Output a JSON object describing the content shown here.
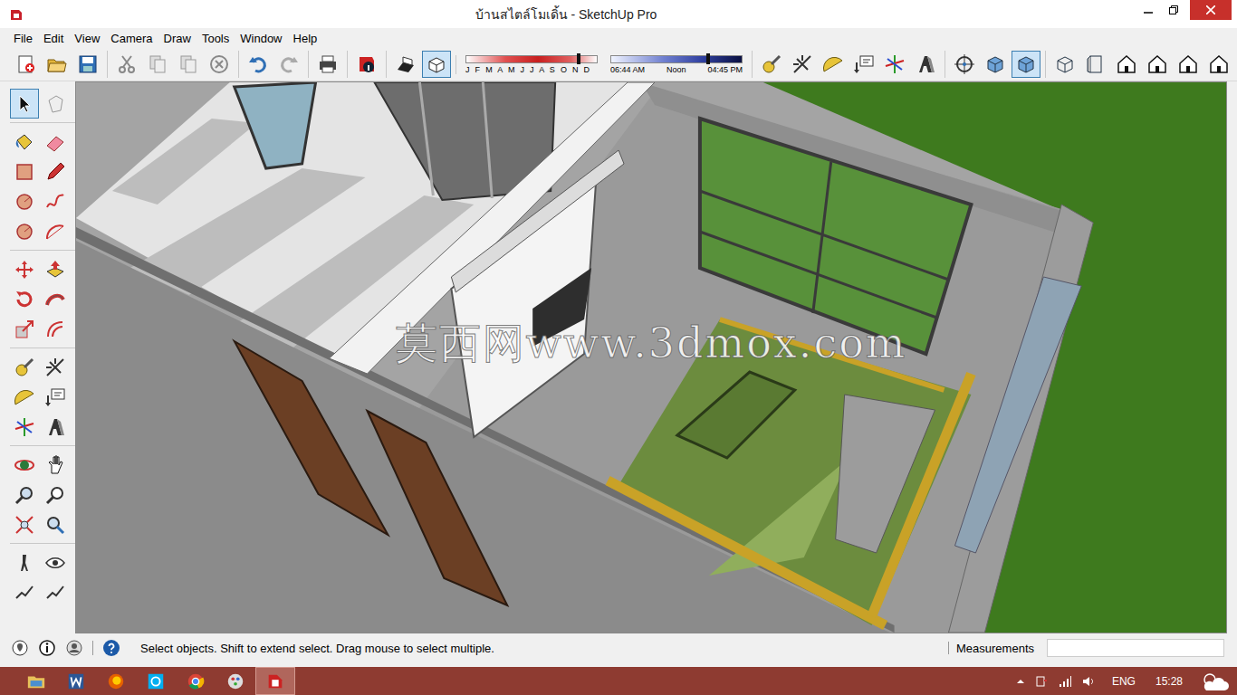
{
  "window": {
    "title": "บ้านสไตล์โมเดิ้น - SketchUp Pro"
  },
  "menu": [
    "File",
    "Edit",
    "View",
    "Camera",
    "Draw",
    "Tools",
    "Window",
    "Help"
  ],
  "toolbar": {
    "left_groups": [
      [
        {
          "pressed": false
        },
        {
          "pressed": false
        },
        {
          "pressed": false
        }
      ],
      [
        {
          "pressed": false
        },
        {
          "pressed": false
        },
        {
          "pressed": false
        },
        {
          "pressed": false
        }
      ],
      [
        {
          "pressed": false
        },
        {
          "pressed": false
        }
      ],
      [
        {
          "pressed": false
        }
      ],
      [
        {
          "pressed": false
        }
      ],
      [
        {
          "pressed": false
        },
        {
          "pressed": true
        }
      ]
    ],
    "shadow": {
      "months": "J F M A M J J A S O N D",
      "date_level": 0.86,
      "times": [
        "06:44 AM",
        "Noon",
        "04:45 PM"
      ],
      "time_level": 0.74
    },
    "right_groups": [
      [
        {
          "pressed": false
        },
        {
          "pressed": false
        },
        {
          "pressed": false
        },
        {
          "pressed": false
        },
        {
          "pressed": false
        },
        {
          "pressed": false
        }
      ],
      [
        {
          "pressed": false
        },
        {
          "pressed": false
        },
        {
          "pressed": true
        }
      ],
      [
        {
          "pressed": false
        },
        {
          "pressed": false
        },
        {
          "pressed": false
        },
        {
          "pressed": false
        },
        {
          "pressed": false
        },
        {
          "pressed": false
        }
      ]
    ]
  },
  "tools": {
    "groups": [
      [
        {
          "selected": true
        },
        {
          "selected": false
        }
      ],
      [
        {
          "selected": false
        },
        {
          "selected": false
        },
        {
          "selected": false
        },
        {
          "selected": false
        },
        {
          "selected": false
        },
        {
          "selected": false
        },
        {
          "selected": false
        },
        {
          "selected": false
        }
      ],
      [
        {
          "selected": false
        },
        {
          "selected": false
        },
        {
          "selected": false
        },
        {
          "selected": false
        },
        {
          "selected": false
        },
        {
          "selected": false
        }
      ],
      [
        {
          "selected": false
        },
        {
          "selected": false
        },
        {
          "selected": false
        },
        {
          "selected": false
        },
        {
          "selected": false
        },
        {
          "selected": false
        }
      ],
      [
        {
          "selected": false
        },
        {
          "selected": false
        },
        {
          "selected": false
        },
        {
          "selected": false
        },
        {
          "selected": false
        },
        {
          "selected": false
        }
      ],
      [
        {
          "selected": false
        },
        {
          "selected": false
        },
        {
          "selected": false
        },
        {
          "selected": false
        }
      ]
    ]
  },
  "viewport": {
    "watermark": "莫西网www.3dmox.com"
  },
  "status_bar": {
    "hint": "Select objects. Shift to extend select. Drag mouse to select multiple.",
    "measurements_label": "Measurements",
    "measurements_value": ""
  },
  "taskbar": {
    "apps": [
      {
        "selected": false
      },
      {
        "selected": false
      },
      {
        "selected": false
      },
      {
        "selected": false
      },
      {
        "selected": false
      },
      {
        "selected": false
      },
      {
        "selected": true
      }
    ],
    "language": "ENG",
    "clock": "15:28"
  }
}
